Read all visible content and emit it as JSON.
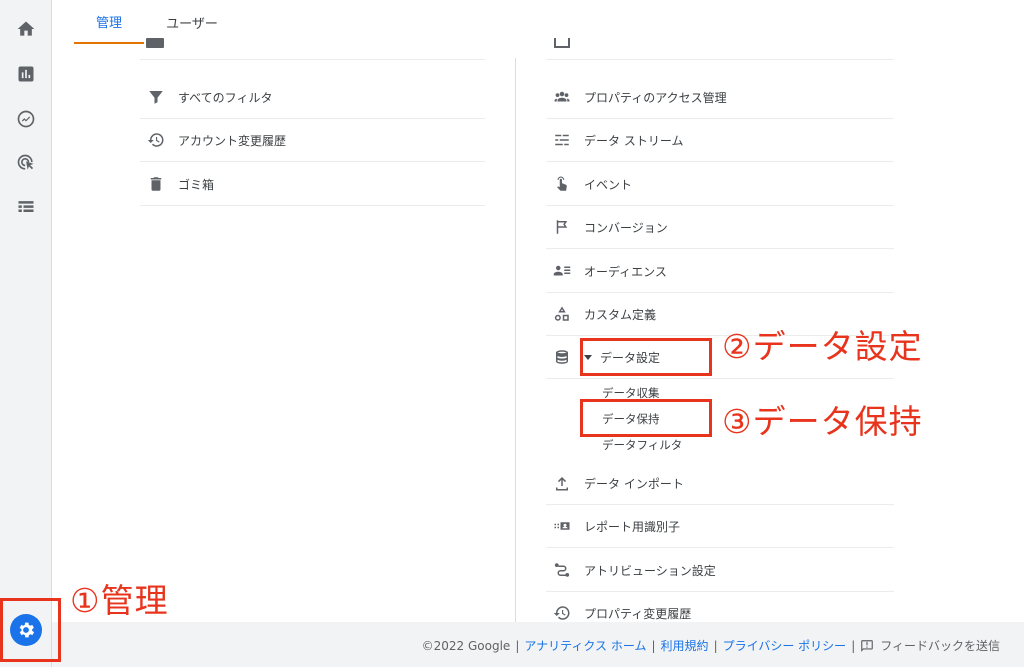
{
  "tabs": {
    "admin": "管理",
    "users": "ユーザー"
  },
  "rail": {
    "items": [
      {
        "icon": "home-icon"
      },
      {
        "icon": "reports-icon"
      },
      {
        "icon": "explore-icon"
      },
      {
        "icon": "advertising-icon"
      },
      {
        "icon": "list-icon"
      }
    ],
    "settings_icon": "gear-icon"
  },
  "account_column": {
    "items": [
      {
        "label": "すべてのフィルタ",
        "icon": "filter-icon"
      },
      {
        "label": "アカウント変更履歴",
        "icon": "history-icon"
      },
      {
        "label": "ゴミ箱",
        "icon": "trash-icon"
      }
    ]
  },
  "property_column": {
    "items": [
      {
        "label": "プロパティのアクセス管理",
        "icon": "people-icon"
      },
      {
        "label": "データ ストリーム",
        "icon": "streams-icon"
      },
      {
        "label": "イベント",
        "icon": "touch-icon"
      },
      {
        "label": "コンバージョン",
        "icon": "flag-icon"
      },
      {
        "label": "オーディエンス",
        "icon": "audience-icon"
      },
      {
        "label": "カスタム定義",
        "icon": "shapes-icon"
      },
      {
        "label": "データ設定",
        "icon": "database-icon",
        "expanded": true
      },
      {
        "label": "データ インポート",
        "icon": "upload-icon"
      },
      {
        "label": "レポート用識別子",
        "icon": "identity-icon"
      },
      {
        "label": "アトリビューション設定",
        "icon": "attribution-icon"
      },
      {
        "label": "プロパティ変更履歴",
        "icon": "history-icon"
      }
    ],
    "data_settings_sub": [
      "データ収集",
      "データ保持",
      "データフィルタ"
    ]
  },
  "annotations": {
    "step1": "①管理",
    "step2": "②データ設定",
    "step3": "③データ保持",
    "color": "#e8341c"
  },
  "footer": {
    "copyright": "©2022 Google",
    "links": [
      "アナリティクス ホーム",
      "利用規約",
      "プライバシー ポリシー"
    ],
    "feedback": "フィードバックを送信"
  },
  "colors": {
    "accent": "#1a73e8",
    "tab_underline": "#e37400"
  }
}
